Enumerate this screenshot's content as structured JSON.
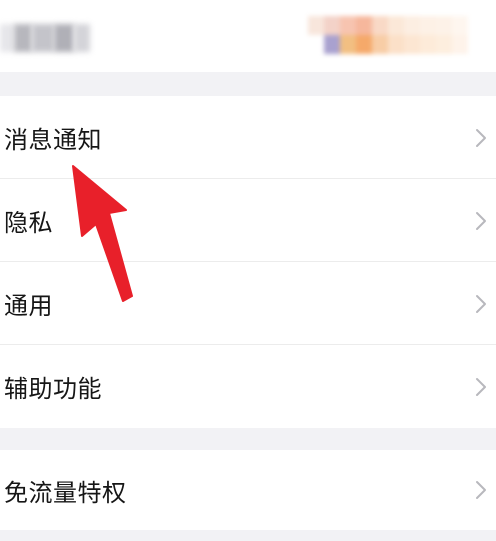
{
  "settings_menu": {
    "items": [
      {
        "label": "消息通知"
      },
      {
        "label": "隐私"
      },
      {
        "label": "通用"
      },
      {
        "label": "辅助功能"
      }
    ],
    "extra_items": [
      {
        "label": "免流量特权"
      }
    ]
  },
  "colors": {
    "annotation_arrow": "#e8202a",
    "section_gap": "#f2f2f5",
    "chevron": "#b8b8bd",
    "text": "#161616"
  }
}
